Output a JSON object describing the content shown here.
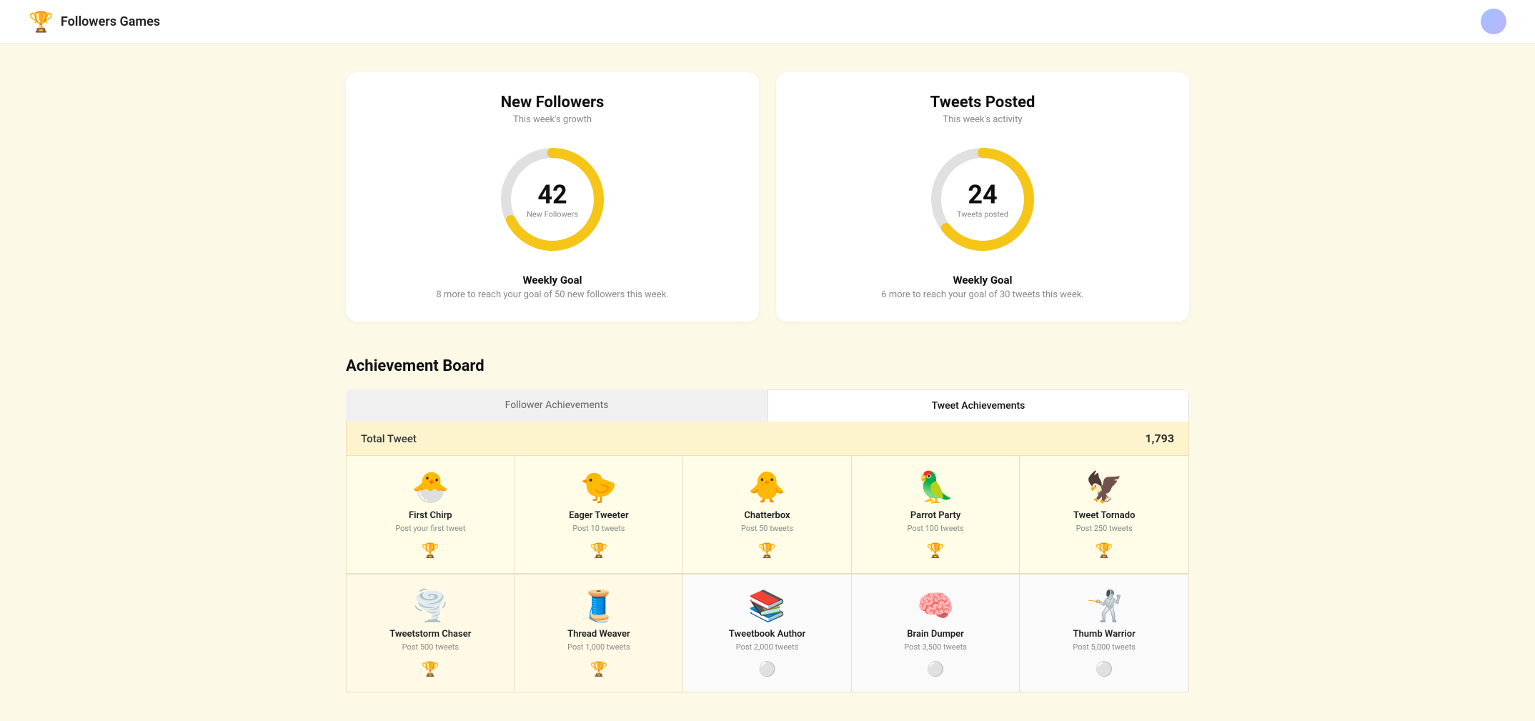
{
  "header": {
    "title": "Followers Games",
    "logo_emoji": "🏆"
  },
  "new_followers": {
    "title": "New Followers",
    "subtitle": "This week's growth",
    "value": 42,
    "label": "New Followers",
    "goal_title": "Weekly Goal",
    "goal_text": "8 more to reach your goal of 50 new followers this week.",
    "progress": 84,
    "track_color": "#e0e0e0",
    "fill_color": "#f5c518"
  },
  "tweets_posted": {
    "title": "Tweets Posted",
    "subtitle": "This week's activity",
    "value": 24,
    "label": "Tweets posted",
    "goal_title": "Weekly Goal",
    "goal_text": "6 more to reach your goal of 30 tweets this week.",
    "progress": 80,
    "track_color": "#e0e0e0",
    "fill_color": "#f5c518"
  },
  "achievement_board": {
    "title": "Achievement Board",
    "tabs": [
      {
        "label": "Follower Achievements",
        "active": false
      },
      {
        "label": "Tweet Achievements",
        "active": true
      }
    ],
    "total_label": "Total Tweet",
    "total_value": "1,793",
    "achievements_row1": [
      {
        "name": "First Chirp",
        "desc": "Post your first tweet",
        "emoji": "🐣",
        "trophy_level": "gold",
        "unlocked": true
      },
      {
        "name": "Eager Tweeter",
        "desc": "Post 10 tweets",
        "emoji": "🐤",
        "trophy_level": "gold",
        "unlocked": true
      },
      {
        "name": "Chatterbox",
        "desc": "Post 50 tweets",
        "emoji": "🐥",
        "trophy_level": "gold",
        "unlocked": true
      },
      {
        "name": "Parrot Party",
        "desc": "Post 100 tweets",
        "emoji": "🦜",
        "trophy_level": "gold",
        "unlocked": true
      },
      {
        "name": "Tweet Tornado",
        "desc": "Post 250 tweets",
        "emoji": "🦅",
        "trophy_level": "gold",
        "unlocked": true
      }
    ],
    "achievements_row2": [
      {
        "name": "Tweetstorm Chaser",
        "desc": "Post 500 tweets",
        "emoji": "🌪️",
        "trophy_level": "gold",
        "unlocked": true
      },
      {
        "name": "Thread Weaver",
        "desc": "Post 1,000 tweets",
        "emoji": "🧵",
        "trophy_level": "gold",
        "unlocked": true
      },
      {
        "name": "Tweetbook Author",
        "desc": "Post 2,000 tweets",
        "emoji": "📚",
        "trophy_level": "gray",
        "unlocked": false
      },
      {
        "name": "Brain Dumper",
        "desc": "Post 3,500 tweets",
        "emoji": "🧠",
        "trophy_level": "gray",
        "unlocked": false
      },
      {
        "name": "Thumb Warrior",
        "desc": "Post 5,000 tweets",
        "emoji": "🤺",
        "trophy_level": "gray",
        "unlocked": false
      }
    ]
  }
}
